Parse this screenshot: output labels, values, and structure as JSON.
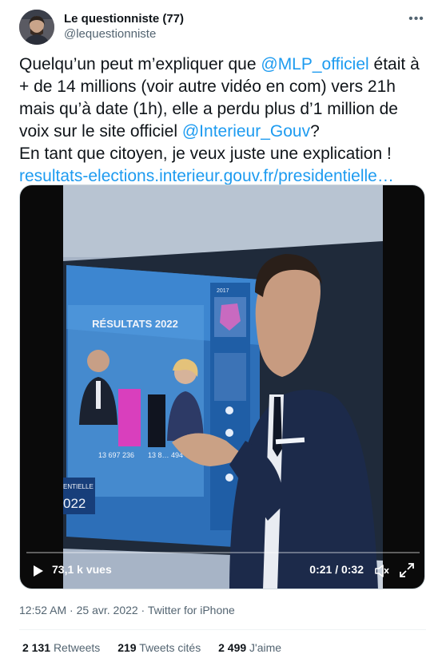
{
  "author": {
    "display_name": "Le questionniste (77)",
    "handle": "@lequestionniste",
    "more_glyph": "•••"
  },
  "tweet": {
    "text_part1": "Quelqu’un peut m’expliquer que ",
    "mention1": "@MLP_officiel",
    "text_part2": " était à + de 14 millions (voir autre vidéo en com) vers 21h mais qu’à date (1h), elle a perdu plus d’1 million de voix sur le site officiel ",
    "mention2": "@Interieur_Gouv",
    "text_part3": "?",
    "line2": "En tant que citoyen, je veux juste une explication !",
    "url": "resultats-elections.interieur.gouv.fr/presidentielle…"
  },
  "video": {
    "views": "73,1 k vues",
    "time": "0:21 / 0:32",
    "progress_fraction": 0.0,
    "screen_title": "RÉSULTATS 2022",
    "screen_year_small": "2017",
    "value_left": "13 697 236",
    "value_right": "13 8… 494",
    "corner_label_top": "ENTIELLE",
    "corner_label_year": "022"
  },
  "meta": {
    "time": "12:52 AM",
    "sep": " · ",
    "date": "25 avr. 2022",
    "source": "Twitter for iPhone"
  },
  "stats": {
    "retweets_count": "2 131",
    "retweets_label": "Retweets",
    "quotes_count": "219",
    "quotes_label": "Tweets cités",
    "likes_count": "2 499",
    "likes_label": "J'aime"
  },
  "colors": {
    "link": "#1d9bf0",
    "bar_magenta": "#d93fbd",
    "bar_dark": "#10141f"
  },
  "icons": {
    "play": "play-icon",
    "mute": "mute-icon",
    "expand": "expand-icon",
    "more": "more-icon"
  }
}
